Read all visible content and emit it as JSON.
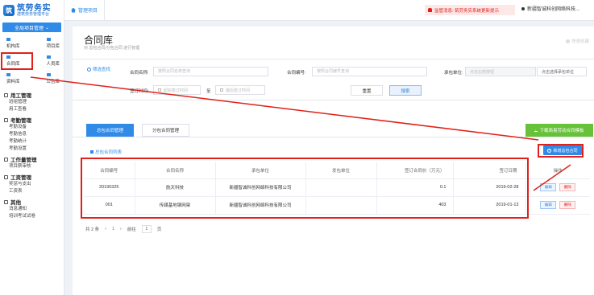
{
  "app": {
    "logo_title": "筑劳务实",
    "logo_sub": "建筑劳务管理平台",
    "logo_mark": "筑"
  },
  "sidebar": {
    "project_button": "全局项目管理",
    "grid": [
      {
        "label": "机构库"
      },
      {
        "label": "项目库"
      },
      {
        "label": "合同库"
      },
      {
        "label": "人员库"
      },
      {
        "label": "资料库"
      },
      {
        "label": "公告库"
      }
    ],
    "sections": [
      {
        "title": "用工管理",
        "items": [
          "班组管理",
          "用工查看"
        ]
      },
      {
        "title": "考勤管理",
        "items": [
          "考勤设备",
          "考勤信息",
          "考勤统计",
          "考勤设置"
        ]
      },
      {
        "title": "工作量管理",
        "items": [
          "项目薪审核"
        ]
      },
      {
        "title": "工资管理",
        "items": [
          "奖惩与支出",
          "工资表"
        ]
      },
      {
        "title": "其他",
        "items": [
          "消息通知",
          "培训考试试卷"
        ]
      }
    ]
  },
  "topbar": {
    "home_tab": "管理项目",
    "notice": "监管消息: 筑劳务实系统更新提示",
    "company": "新疆智诚科创网络科技..."
  },
  "page": {
    "title": "合同库",
    "subtitle": "对 总包合同/分包合同 进行管理",
    "quick_create": "快速创建"
  },
  "filter": {
    "head": "筛选查找",
    "contract_name_label": "合同名称:",
    "contract_name_placeholder": "按照合同名称查询",
    "contract_no_label": "合同编号:",
    "contract_no_placeholder": "按照合同编号查询",
    "contractor_label": "承包单位:",
    "contractor_value": "点击右侧按钮",
    "contractor_select": "点击选择承包单位",
    "sign_time_label": "签订时间:",
    "start_placeholder": "起始签订时间",
    "to": "至",
    "end_placeholder": "最后签订时间",
    "reset": "重置",
    "search": "搜索"
  },
  "tabs": {
    "items": [
      "总包合同管理",
      "分包合同管理"
    ],
    "active": 0,
    "download": "下载简易劳动合同模板"
  },
  "list": {
    "head": "总包合同列表",
    "new_button": "新增总包合同",
    "columns": [
      "合同编号",
      "合同名称",
      "承包单位",
      "发包单位",
      "签订合同价（万元）",
      "签订日期",
      "操作"
    ],
    "rows": [
      {
        "no": "20190325",
        "name": "航天科技",
        "contractor": "新疆智诚科创网络科技有限公司",
        "issuer": "",
        "price": "0.1",
        "date": "2019-02-28"
      },
      {
        "no": "001",
        "name": "传媒基地钢网架",
        "contractor": "新疆智诚科创网络科技有限公司",
        "issuer": "",
        "price": "403",
        "date": "2019-01-13"
      }
    ],
    "edit_label": "编辑",
    "delete_label": "删除"
  },
  "pager": {
    "total": "共 2 条",
    "prev": "‹",
    "page": "1",
    "next": "›",
    "goto_label": "前往",
    "goto_value": "1",
    "page_unit": "页"
  },
  "colors": {
    "primary": "#2f8ae8",
    "annotation": "#e0201a",
    "success": "#67c23a"
  }
}
